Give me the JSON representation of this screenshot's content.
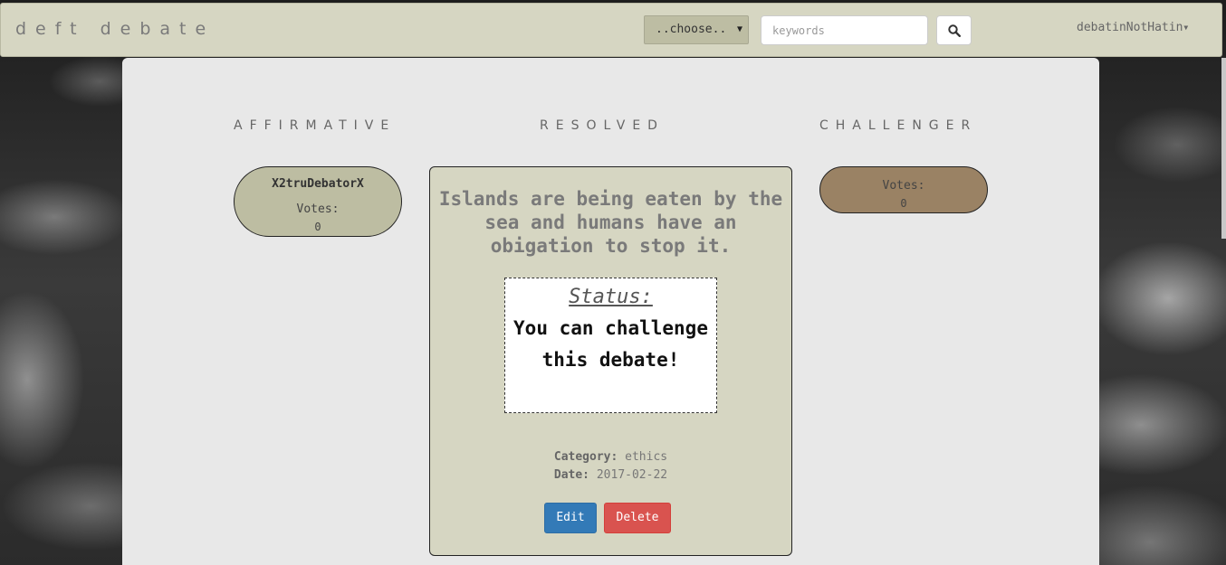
{
  "nav": {
    "brand": "deft debate",
    "category_select": "..choose..",
    "search_placeholder": "keywords",
    "user": "debatinNotHatin"
  },
  "columns": {
    "affirmative": "AFFIRMATIVE",
    "resolved": "RESOLVED",
    "challenger": "CHALLENGER"
  },
  "affirmative": {
    "name": "X2truDebatorX",
    "votes_label": "Votes:",
    "votes": "0"
  },
  "challenger": {
    "votes_label": "Votes:",
    "votes": "0"
  },
  "debate": {
    "resolution": "Islands are being eaten by the sea and humans have an obigation to stop it.",
    "status_label": "Status:",
    "status_text": "You can challenge this debate!",
    "category_label": "Category:",
    "category": "ethics",
    "date_label": "Date:",
    "date": "2017-02-22",
    "edit_label": "Edit",
    "delete_label": "Delete"
  },
  "colors": {
    "navbar": "#d6d6c2",
    "affirmative_pill": "#bdbda2",
    "challenger_pill": "#9a8264",
    "edit_button": "#337ab7",
    "delete_button": "#d9534f"
  }
}
